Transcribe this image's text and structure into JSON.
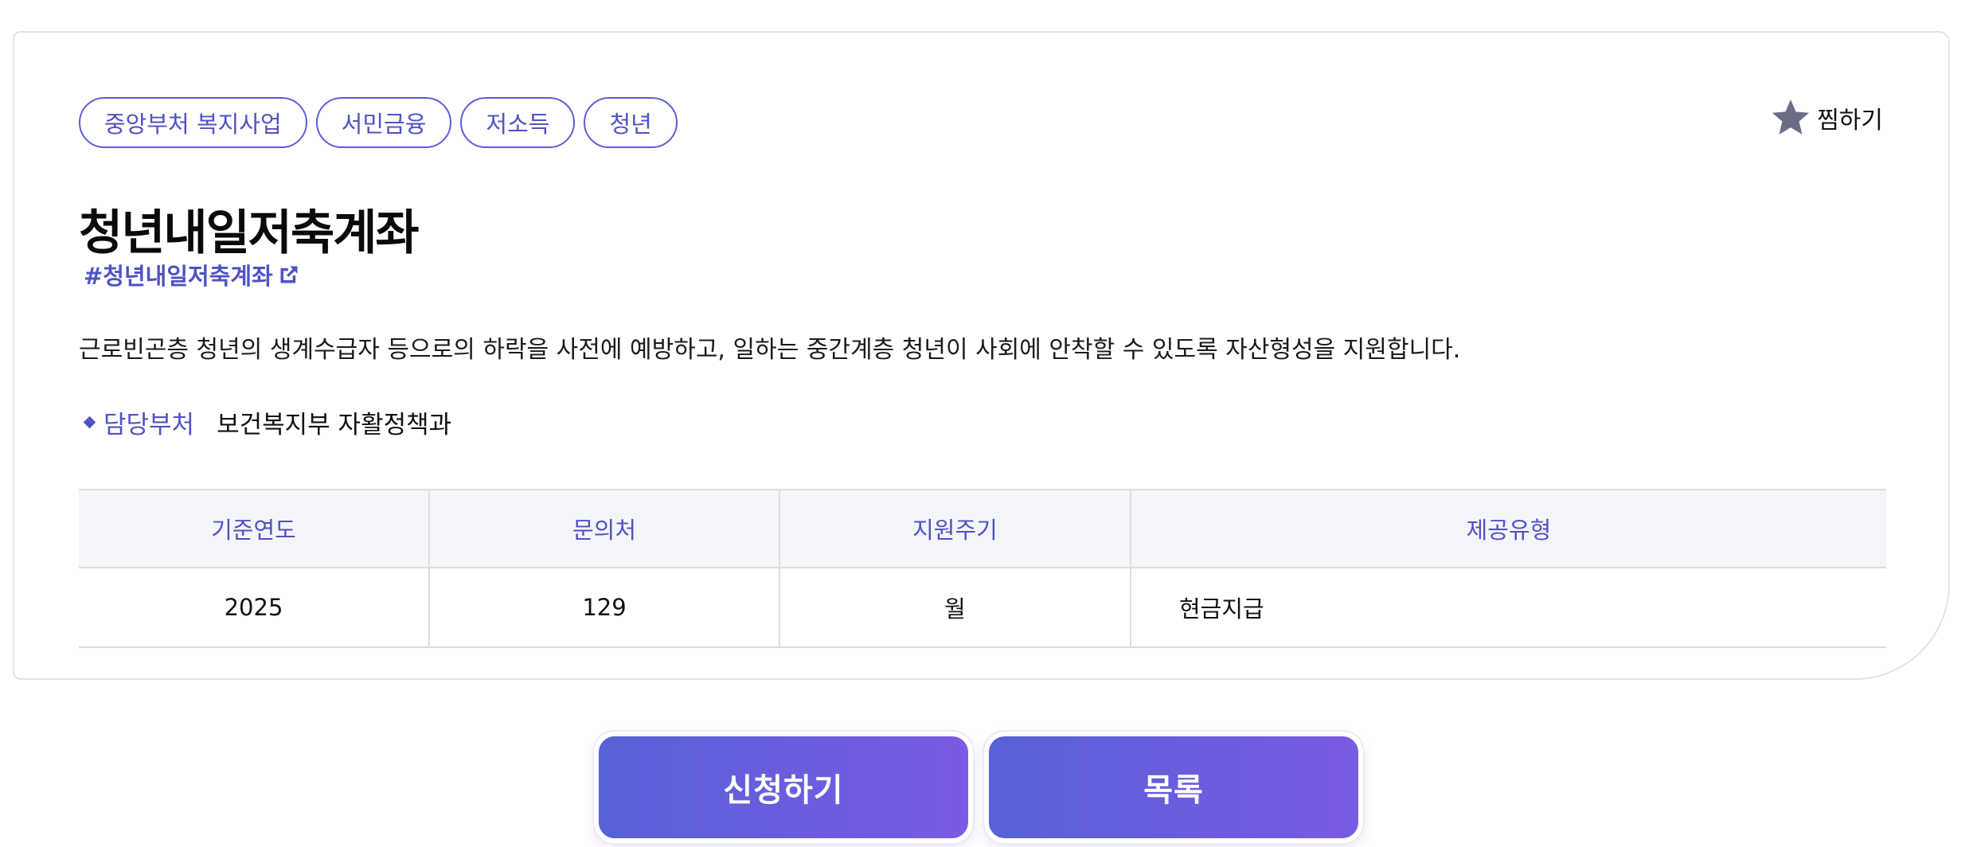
{
  "tags": [
    "중앙부처 복지사업",
    "서민금융",
    "저소득",
    "청년"
  ],
  "favorite": {
    "label": "찜하기",
    "icon": "star-icon",
    "icon_color": "#6b6d86"
  },
  "title": "청년내일저축계좌",
  "hashtag": {
    "label": "#청년내일저축계좌",
    "icon": "external-link-icon"
  },
  "description": "근로빈곤층 청년의 생계수급자 등으로의 하락을 사전에 예방하고, 일하는 중간계층 청년이 사회에 안착할 수 있도록 자산형성을 지원합니다.",
  "department": {
    "label": "담당부처",
    "value": "보건복지부 자활정책과"
  },
  "info_table": {
    "headers": [
      "기준연도",
      "문의처",
      "지원주기",
      "제공유형"
    ],
    "row": [
      "2025",
      "129",
      "월",
      "현금지급"
    ]
  },
  "buttons": {
    "apply": "신청하기",
    "list": "목록"
  },
  "colors": {
    "accent": "#4f52c4",
    "button_start": "#5861d6",
    "button_end": "#7a5be3"
  }
}
